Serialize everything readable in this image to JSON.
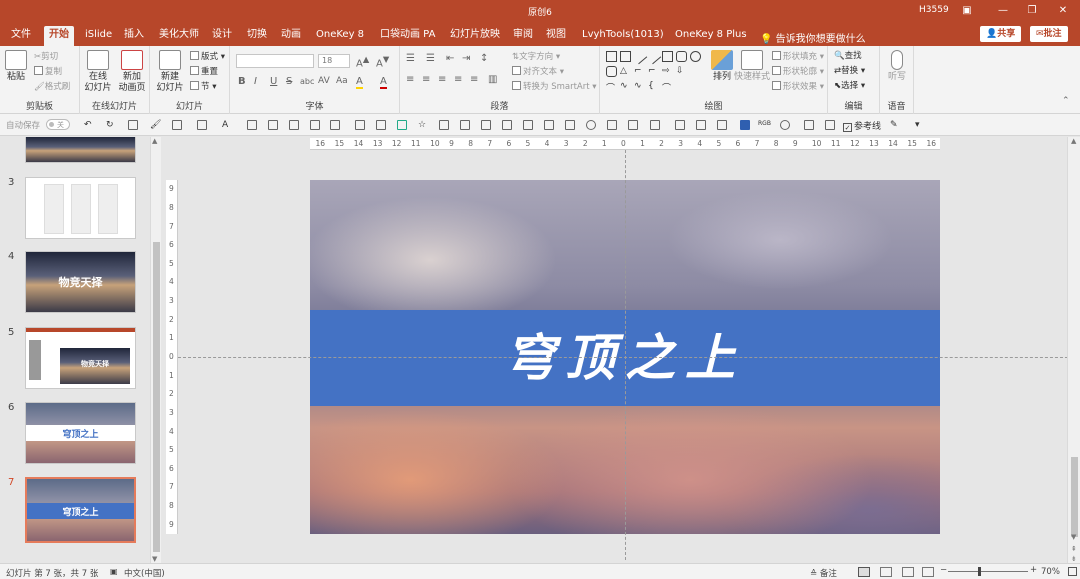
{
  "window": {
    "title": "原创6",
    "user": "H3559",
    "controls": [
      "▣",
      "—",
      "❐",
      "✕"
    ]
  },
  "tabs": [
    "文件",
    "开始",
    "iSlide",
    "插入",
    "美化大师",
    "设计",
    "切换",
    "动画",
    "OneKey 8",
    "口袋动画 PA",
    "幻灯片放映",
    "审阅",
    "视图",
    "LvyhTools(1013)",
    "OneKey 8 Plus"
  ],
  "tell_me": "告诉我你想要做什么",
  "share": "共享",
  "comments": "批注",
  "ribbon": {
    "clipboard": {
      "paste": "粘贴",
      "cut": "剪切",
      "copy": "复制",
      "format_painter": "格式刷",
      "label": "剪贴板"
    },
    "online_slides": {
      "online": "在线\n幻灯片",
      "new_anim": "新加\n动画页",
      "label": "在线幻灯片"
    },
    "slides": {
      "new_slide": "新建\n幻灯片",
      "layout": "版式",
      "reset": "重置",
      "section": "节",
      "label": "幻灯片"
    },
    "font": {
      "size": "18",
      "label": "字体",
      "bold": "B",
      "italic": "I",
      "underline": "U",
      "strike": "S",
      "shadow": "abc",
      "spacing": "AV",
      "case": "Aa",
      "highlight": "A",
      "color": "A"
    },
    "paragraph": {
      "text_direction": "文字方向",
      "align_text": "对齐文本",
      "smartart": "转换为 SmartArt",
      "label": "段落"
    },
    "drawing": {
      "arrange": "排列",
      "quick_styles": "快速样式",
      "fill": "形状填充",
      "outline": "形状轮廓",
      "effects": "形状效果",
      "label": "绘图"
    },
    "editing": {
      "find": "查找",
      "replace": "替换",
      "select": "选择",
      "label": "编辑"
    },
    "voice": {
      "dictate": "听写",
      "label": "语音"
    }
  },
  "qat": {
    "autosave": "自动保存",
    "autosave_state": "关",
    "reference_line": "参考线"
  },
  "thumbnails": [
    {
      "num": "3"
    },
    {
      "num": "4",
      "text": "物竞天择"
    },
    {
      "num": "5",
      "text": "物竞天择"
    },
    {
      "num": "6",
      "text": "穹顶之上"
    },
    {
      "num": "7",
      "text": "穹顶之上",
      "selected": true
    }
  ],
  "ruler": {
    "h_ticks": [
      "16",
      "15",
      "14",
      "13",
      "12",
      "11",
      "10",
      "9",
      "8",
      "7",
      "6",
      "5",
      "4",
      "3",
      "2",
      "1",
      "0",
      "1",
      "2",
      "3",
      "4",
      "5",
      "6",
      "7",
      "8",
      "9",
      "10",
      "11",
      "12",
      "13",
      "14",
      "15",
      "16"
    ],
    "v_ticks": [
      "9",
      "8",
      "7",
      "6",
      "5",
      "4",
      "3",
      "2",
      "1",
      "0",
      "1",
      "2",
      "3",
      "4",
      "5",
      "6",
      "7",
      "8",
      "9"
    ]
  },
  "slide": {
    "title": "穹顶之上",
    "banner_color": "#4472c4"
  },
  "status": {
    "slide_info": "幻灯片 第 7 张，共 7 张",
    "language": "中文(中国)",
    "notes": "备注",
    "zoom": "70%"
  },
  "colors": {
    "accent": "#b7472a",
    "banner": "#4472c4"
  }
}
